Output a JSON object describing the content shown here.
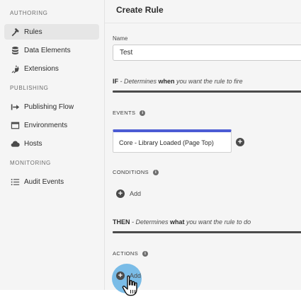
{
  "sidebar": {
    "sections": [
      {
        "heading": "AUTHORING",
        "items": [
          {
            "label": "Rules",
            "icon": "hammer-icon",
            "active": true
          },
          {
            "label": "Data Elements",
            "icon": "database-icon",
            "active": false
          },
          {
            "label": "Extensions",
            "icon": "plug-icon",
            "active": false
          }
        ]
      },
      {
        "heading": "PUBLISHING",
        "items": [
          {
            "label": "Publishing Flow",
            "icon": "publish-flow-icon",
            "active": false
          },
          {
            "label": "Environments",
            "icon": "window-icon",
            "active": false
          },
          {
            "label": "Hosts",
            "icon": "cloud-icon",
            "active": false
          }
        ]
      },
      {
        "heading": "MONITORING",
        "items": [
          {
            "label": "Audit Events",
            "icon": "list-icon",
            "active": false
          }
        ]
      }
    ]
  },
  "header": {
    "title": "Create Rule"
  },
  "form": {
    "name_label": "Name",
    "name_value": "Test",
    "if_section": {
      "keyword": "IF",
      "prefix": " - Determines ",
      "emphasis": "when",
      "suffix": " you want the rule to fire"
    },
    "events": {
      "label": "EVENTS",
      "items": [
        {
          "label": "Core - Library Loaded (Page Top)"
        }
      ]
    },
    "conditions": {
      "label": "CONDITIONS",
      "add_label": "Add"
    },
    "then_section": {
      "keyword": "THEN",
      "prefix": " - Determines ",
      "emphasis": "what",
      "suffix": " you want the rule to do"
    },
    "actions": {
      "label": "ACTIONS",
      "add_label": "Add"
    }
  },
  "colors": {
    "event_accent": "#4b5bd4",
    "cursor_highlight": "#50a8e2",
    "sidebar_bg": "#f5f5f5",
    "active_item_bg": "#e6e6e6"
  }
}
